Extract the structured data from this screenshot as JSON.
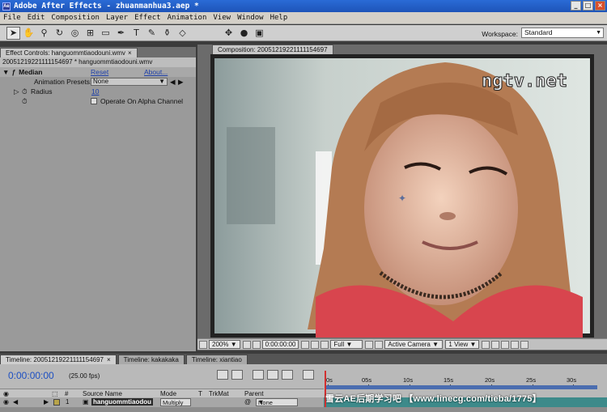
{
  "window": {
    "title": "Adobe After Effects - zhuanmanhua3.aep *"
  },
  "menu": [
    "File",
    "Edit",
    "Composition",
    "Layer",
    "Effect",
    "Animation",
    "View",
    "Window",
    "Help"
  ],
  "toolbar": {
    "workspace_label": "Workspace:",
    "workspace_value": "Standard"
  },
  "effect_controls": {
    "tab_label": "Effect Controls: hanguommtiaodouni.wmv",
    "subtitle": "20051219221111154697 * hanguommtiaodouni.wmv",
    "effect_name": "Median",
    "reset": "Reset",
    "about": "About...",
    "presets_label": "Animation Presets:",
    "presets_value": "None",
    "radius_label": "Radius",
    "radius_value": "10",
    "alpha_label": "Operate On Alpha Channel"
  },
  "composition": {
    "tab_label": "Composition: 20051219221111154697",
    "overlay_text": "ngtv.net",
    "zoom": "200%",
    "timecode": "0:00:00:00",
    "resolution": "Full",
    "camera": "Active Camera",
    "view": "1 View"
  },
  "timeline": {
    "tabs": [
      "Timeline: 20051219221111154697",
      "Timeline: kakakaka",
      "Timeline: xiantiao"
    ],
    "timecode": "0:00:00:00",
    "fps": "(25.00 fps)",
    "col_number": "#",
    "col_source": "Source Name",
    "col_mode": "Mode",
    "col_t": "T",
    "col_trkmat": "TrkMat",
    "col_parent": "Parent",
    "layer_number": "1",
    "layer_name": "hanguommtiaodou",
    "layer_mode": "Multiply",
    "layer_parent": "None",
    "ruler_ticks": [
      "0s",
      "05s",
      "10s",
      "15s",
      "20s",
      "25s",
      "30s"
    ],
    "watermark": "雪云AE后期学习吧 【www.linecg.com/tieba/1775】"
  }
}
